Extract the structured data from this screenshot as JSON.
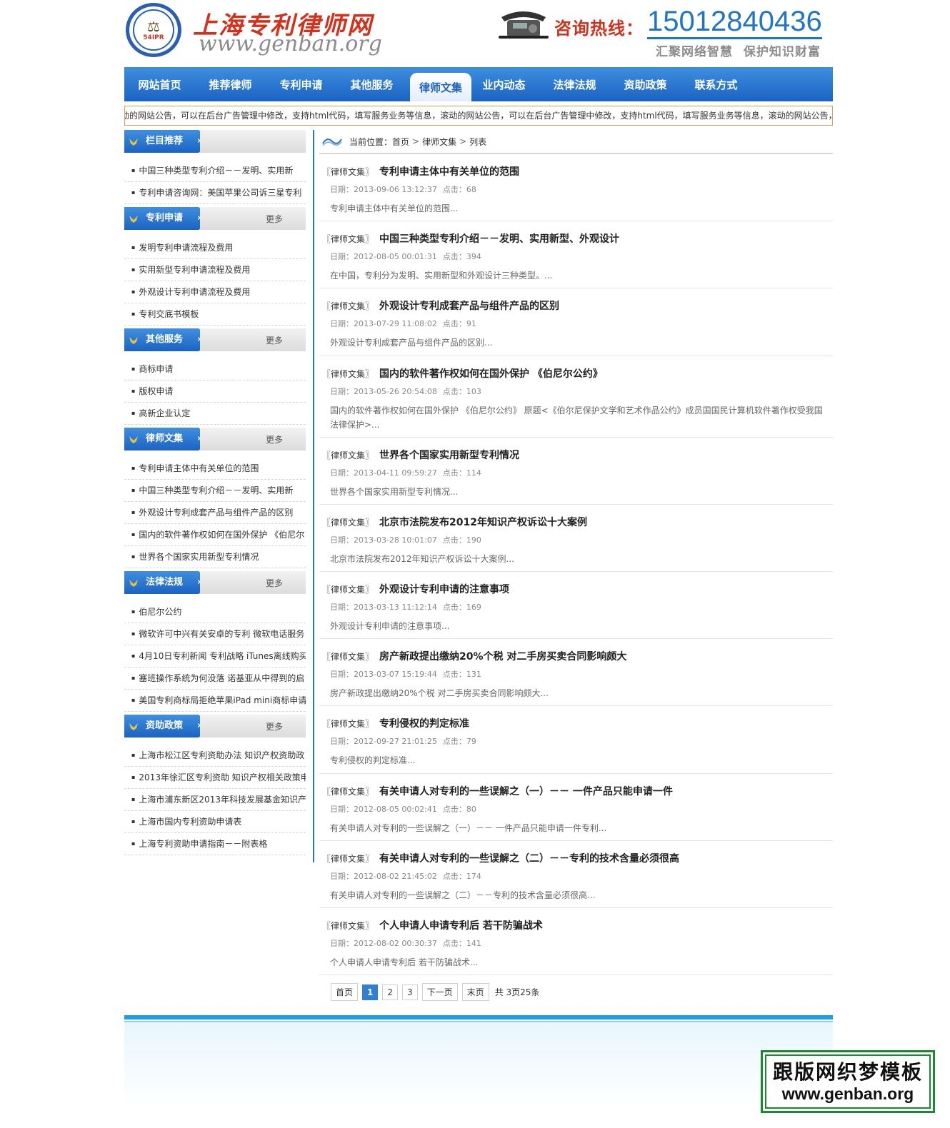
{
  "header": {
    "logo_seal_char": "⚖",
    "logo_seal_tag": "54IPR",
    "site_name": "上海专利律师网",
    "site_url": "www.genban.org",
    "hotline_label": "咨询热线：",
    "hotline_number": "15012840436",
    "slogan": "汇聚网络智慧 保护知识财富"
  },
  "nav": {
    "items": [
      "网站首页",
      "推荐律师",
      "专利申请",
      "其他服务",
      "律师文集",
      "业内动态",
      "法律法规",
      "资助政策",
      "联系方式"
    ]
  },
  "marquee": {
    "text": "动的网站公告，可以在后台广告管理中修改，支持html代码，填写服务业务等信息，滚动的网站公告，可以在后台广告管理中修改，支持html代码，填写服务业务等信息，滚动的网站公告，i"
  },
  "sidebar": {
    "more_label": "更多",
    "sections": [
      {
        "title": "栏目推荐",
        "items": [
          "中国三种类型专利介绍－－发明、实用新",
          "专利申请咨询网：美国苹果公司诉三星专利"
        ]
      },
      {
        "title": "专利申请",
        "items": [
          "发明专利申请流程及费用",
          "实用新型专利申请流程及费用",
          "外观设计专利申请流程及费用",
          "专利交底书模板"
        ]
      },
      {
        "title": "其他服务",
        "items": [
          "商标申请",
          "版权申请",
          "高新企业认定"
        ]
      },
      {
        "title": "律师文集",
        "items": [
          "专利申请主体中有关单位的范围",
          "中国三种类型专利介绍－－发明、实用新",
          "外观设计专利成套产品与组件产品的区别",
          "国内的软件著作权如何在国外保护 《伯尼尔",
          "世界各个国家实用新型专利情况"
        ]
      },
      {
        "title": "法律法规",
        "items": [
          "伯尼尔公约",
          "微软许可中兴有关安卓的专利 微软电话服务",
          "4月10日专利新闻 专利战略 iTunes离线购买",
          "塞班操作系统为何没落 诺基亚从中得到的启",
          "美国专利商标局拒绝苹果iPad mini商标申请"
        ]
      },
      {
        "title": "资助政策",
        "items": [
          "上海市松江区专利资助办法 知识产权资助政",
          "2013年徐汇区专利资助 知识产权相关政策申",
          "上海市浦东新区2013年科技发展基金知识产",
          "上海市国内专利资助申请表",
          "上海专利资助申请指南－－附表格"
        ]
      }
    ]
  },
  "breadcrumb": {
    "label": "当前位置：",
    "home": "首页",
    "cat": "律师文集",
    "page": "列表"
  },
  "articles": {
    "cat_label": "〖律师文集〗",
    "date_label": "日期：",
    "clicks_label": "点击：",
    "items": [
      {
        "title": "专利申请主体中有关单位的范围",
        "date": "2013-09-06 13:12:37",
        "clicks": "68",
        "summary": "专利申请主体中有关单位的范围..."
      },
      {
        "title": "中国三种类型专利介绍－－发明、实用新型、外观设计",
        "date": "2012-08-05 00:01:31",
        "clicks": "394",
        "summary": "在中国，专利分为发明、实用新型和外观设计三种类型。..."
      },
      {
        "title": "外观设计专利成套产品与组件产品的区别",
        "date": "2013-07-29 11:08:02",
        "clicks": "91",
        "summary": "外观设计专利成套产品与组件产品的区别..."
      },
      {
        "title": "国内的软件著作权如何在国外保护 《伯尼尔公约》",
        "date": "2013-05-26 20:54:08",
        "clicks": "103",
        "summary": "国内的软件著作权如何在国外保护 《伯尼尔公约》 原题<《伯尔尼保护文学和艺术作品公约》成员国国民计算机软件著作权受我国法律保护>..."
      },
      {
        "title": "世界各个国家实用新型专利情况",
        "date": "2013-04-11 09:59:27",
        "clicks": "114",
        "summary": "世界各个国家实用新型专利情况..."
      },
      {
        "title": "北京市法院发布2012年知识产权诉讼十大案例",
        "date": "2013-03-28 10:01:07",
        "clicks": "190",
        "summary": "北京市法院发布2012年知识产权诉讼十大案例..."
      },
      {
        "title": "外观设计专利申请的注意事项",
        "date": "2013-03-13 11:12:14",
        "clicks": "169",
        "summary": "外观设计专利申请的注意事项..."
      },
      {
        "title": "房产新政提出缴纳20%个税 对二手房买卖合同影响颇大",
        "date": "2013-03-07 15:19:44",
        "clicks": "131",
        "summary": "房产新政提出缴纳20%个税 对二手房买卖合同影响颇大..."
      },
      {
        "title": "专利侵权的判定标准",
        "date": "2012-09-27 21:01:25",
        "clicks": "79",
        "summary": "专利侵权的判定标准..."
      },
      {
        "title": "有关申请人对专利的一些误解之（一）－－ 一件产品只能申请一件",
        "date": "2012-08-05 00:02:41",
        "clicks": "80",
        "summary": "有关申请人对专利的一些误解之（一）－－ 一件产品只能申请一件专利..."
      },
      {
        "title": "有关申请人对专利的一些误解之（二）－－专利的技术含量必须很高",
        "date": "2012-08-02 21:45:02",
        "clicks": "174",
        "summary": "有关申请人对专利的一些误解之（二）－－专利的技术含量必须很高..."
      },
      {
        "title": "个人申请人申请专利后 若干防骗战术",
        "date": "2012-08-02 00:30:37",
        "clicks": "141",
        "summary": "个人申请人申请专利后 若干防骗战术..."
      }
    ]
  },
  "pager": {
    "first": "首页",
    "pages": [
      "1",
      "2",
      "3"
    ],
    "next": "下一页",
    "last": "末页",
    "info": "共 3页25条"
  },
  "watermark": {
    "line1": "跟版网织梦模板",
    "line2": "www.genban.org"
  },
  "colors": {
    "brand_blue": "#1b63c2",
    "accent_red": "#d2311c",
    "link_blue": "#1f76c9"
  }
}
